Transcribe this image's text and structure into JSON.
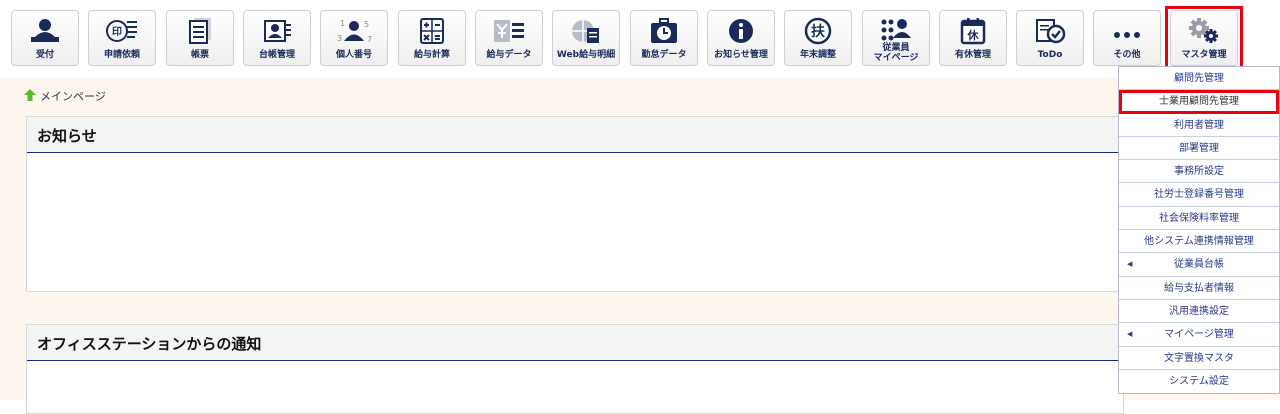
{
  "toolbar": {
    "buttons": [
      {
        "label": "受付",
        "icon": "person-desk-icon"
      },
      {
        "label": "申請依頼",
        "icon": "stamp-request-icon"
      },
      {
        "label": "帳票",
        "icon": "document-stack-icon"
      },
      {
        "label": "台帳管理",
        "icon": "ledger-card-icon"
      },
      {
        "label": "個人番号",
        "icon": "person-number-icon"
      },
      {
        "label": "給与計算",
        "icon": "calculator-icon"
      },
      {
        "label": "給与データ",
        "icon": "salary-data-icon"
      },
      {
        "label": "Web給与明細",
        "icon": "globe-document-icon"
      },
      {
        "label": "勤怠データ",
        "icon": "clock-briefcase-icon"
      },
      {
        "label": "お知らせ管理",
        "icon": "info-icon"
      },
      {
        "label": "年末調整",
        "icon": "fu-circle-icon"
      },
      {
        "label1": "従業員",
        "label2": "マイページ",
        "icon": "employees-icon"
      },
      {
        "label": "有休管理",
        "icon": "calendar-holiday-icon"
      },
      {
        "label": "ToDo",
        "icon": "todo-check-icon"
      },
      {
        "label": "その他",
        "icon": "more-dots-icon"
      },
      {
        "label": "マスタ管理",
        "icon": "gears-icon"
      }
    ],
    "stamp_char": "印",
    "calendar_char": "休",
    "fu_char": "扶",
    "numbers": {
      "n1": "1",
      "n3": "3",
      "n5": "5",
      "n7": "7"
    }
  },
  "breadcrumb": {
    "home_label": "メインページ",
    "icon": "home-arrow-icon"
  },
  "panels": {
    "notice_title": "お知らせ",
    "office_title": "オフィスステーションからの通知"
  },
  "dropdown": {
    "items": [
      {
        "label": "顧問先管理"
      },
      {
        "label": "士業用顧問先管理",
        "selected": true
      },
      {
        "label": "利用者管理"
      },
      {
        "label": "部署管理"
      },
      {
        "label": "事務所設定"
      },
      {
        "label": "社労士登録番号管理"
      },
      {
        "label": "社会保険料率管理"
      },
      {
        "label": "他システム連携情報管理"
      },
      {
        "label": "従業員台帳",
        "submenu": true
      },
      {
        "label": "給与支払者情報"
      },
      {
        "label": "汎用連携設定"
      },
      {
        "label": "マイページ管理",
        "submenu": true
      },
      {
        "label": "文字置換マスタ"
      },
      {
        "label": "システム設定"
      }
    ],
    "submenu_arrow": "◀"
  },
  "colors": {
    "accent": "#1a2a5a",
    "highlight": "#e60012",
    "content_bg": "#fdf6ee",
    "link": "#2a3a8a"
  }
}
